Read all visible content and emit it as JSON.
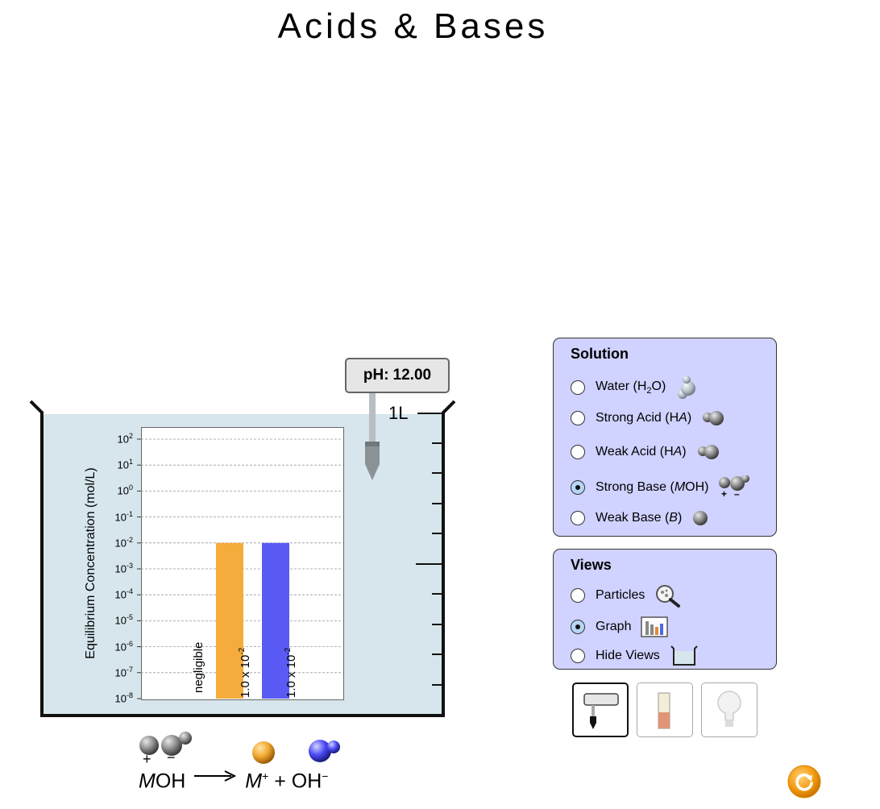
{
  "title": "Acids & Bases",
  "ph_meter": {
    "label": "pH:",
    "value": "12.00"
  },
  "beaker": {
    "volume_label": "1L"
  },
  "graph": {
    "y_axis_label": "Equilibrium Concentration (mol/L)",
    "tick_labels": [
      {
        "base": "10",
        "exp": "2"
      },
      {
        "base": "10",
        "exp": "1"
      },
      {
        "base": "10",
        "exp": "0"
      },
      {
        "base": "10",
        "exp": "-1"
      },
      {
        "base": "10",
        "exp": "-2"
      },
      {
        "base": "10",
        "exp": "-3"
      },
      {
        "base": "10",
        "exp": "-4"
      },
      {
        "base": "10",
        "exp": "-5"
      },
      {
        "base": "10",
        "exp": "-6"
      },
      {
        "base": "10",
        "exp": "-7"
      },
      {
        "base": "10",
        "exp": "-8"
      }
    ],
    "bars": [
      {
        "label": "negligible",
        "log_value": null,
        "color": null
      },
      {
        "label_base": "1.0 x 10",
        "label_exp": "-2",
        "log_value": -2,
        "color": "#f5ac3c"
      },
      {
        "label_base": "1.0 x 10",
        "label_exp": "-2",
        "log_value": -2,
        "color": "#5a5af5"
      }
    ]
  },
  "reaction": {
    "reactant_italic": "M",
    "reactant_rest": "OH",
    "product1_italic": "M",
    "product1_charge": "+",
    "plus": "+",
    "product2": "OH",
    "product2_charge": "−",
    "plus_sign": "+",
    "minus_sign": "−"
  },
  "solution_panel": {
    "heading": "Solution",
    "options": [
      {
        "pre": "Water (H",
        "sub": "2",
        "post": "O)",
        "selected": false
      },
      {
        "pre": "Strong Acid (H",
        "italic": "A",
        "post": ")",
        "selected": false
      },
      {
        "pre": "Weak Acid (H",
        "italic": "A",
        "post": ")",
        "selected": false
      },
      {
        "pre": "Strong Base (",
        "italic": "M",
        "post": "OH)",
        "selected": true
      },
      {
        "pre": "Weak Base (",
        "italic": "B",
        "post": ")",
        "selected": false
      }
    ]
  },
  "views_panel": {
    "heading": "Views",
    "options": [
      {
        "label": "Particles",
        "selected": false
      },
      {
        "label": "Graph",
        "selected": true
      },
      {
        "label": "Hide Views",
        "selected": false
      }
    ]
  },
  "colors": {
    "water": "#d6e6ec",
    "panel": "#d0d2ff",
    "metal_ion": "#f5ac3c",
    "hydroxide": "#5a5af5",
    "reset": "#f39c12"
  }
}
